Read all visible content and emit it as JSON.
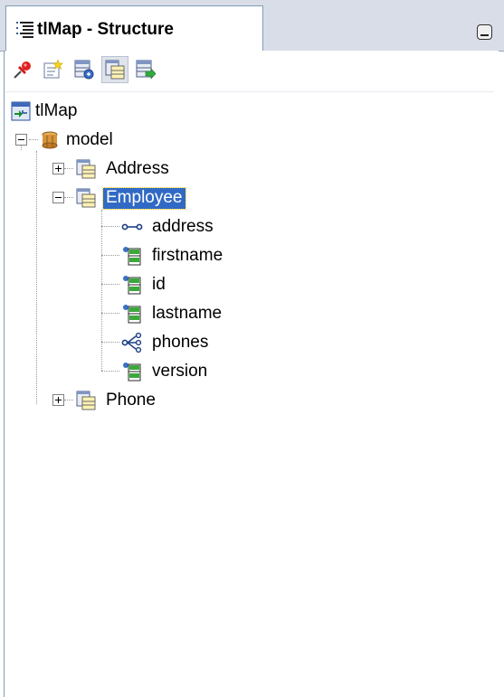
{
  "window": {
    "tab_title": "tlMap - Structure",
    "tab_icon": "structure-outline-icon",
    "minimize_icon": "minimize-icon"
  },
  "toolbar": {
    "buttons": [
      {
        "icon": "pin-icon",
        "pressed": false
      },
      {
        "icon": "new-note-icon",
        "pressed": false
      },
      {
        "icon": "entity-attributes-icon",
        "pressed": false
      },
      {
        "icon": "entity-table-icon",
        "pressed": true
      },
      {
        "icon": "entity-export-icon",
        "pressed": false
      }
    ]
  },
  "tree": {
    "root": {
      "label": "tlMap",
      "icon": "map-icon"
    },
    "package": {
      "label": "model",
      "icon": "package-icon",
      "expanded": true
    },
    "entities": [
      {
        "label": "Address",
        "expanded": false,
        "icon": "entity-icon"
      },
      {
        "label": "Employee",
        "expanded": true,
        "selected": true,
        "icon": "entity-icon",
        "attributes": [
          {
            "label": "address",
            "icon": "one-to-one-icon"
          },
          {
            "label": "firstname",
            "icon": "basic-attribute-icon"
          },
          {
            "label": "id",
            "icon": "basic-attribute-icon"
          },
          {
            "label": "lastname",
            "icon": "basic-attribute-icon"
          },
          {
            "label": "phones",
            "icon": "one-to-many-icon"
          },
          {
            "label": "version",
            "icon": "basic-attribute-icon"
          }
        ]
      },
      {
        "label": "Phone",
        "expanded": false,
        "icon": "entity-icon"
      }
    ]
  },
  "colors": {
    "selection": "#316ac5",
    "tabstrip": "#d9dde7",
    "frame": "#7f9db9"
  }
}
